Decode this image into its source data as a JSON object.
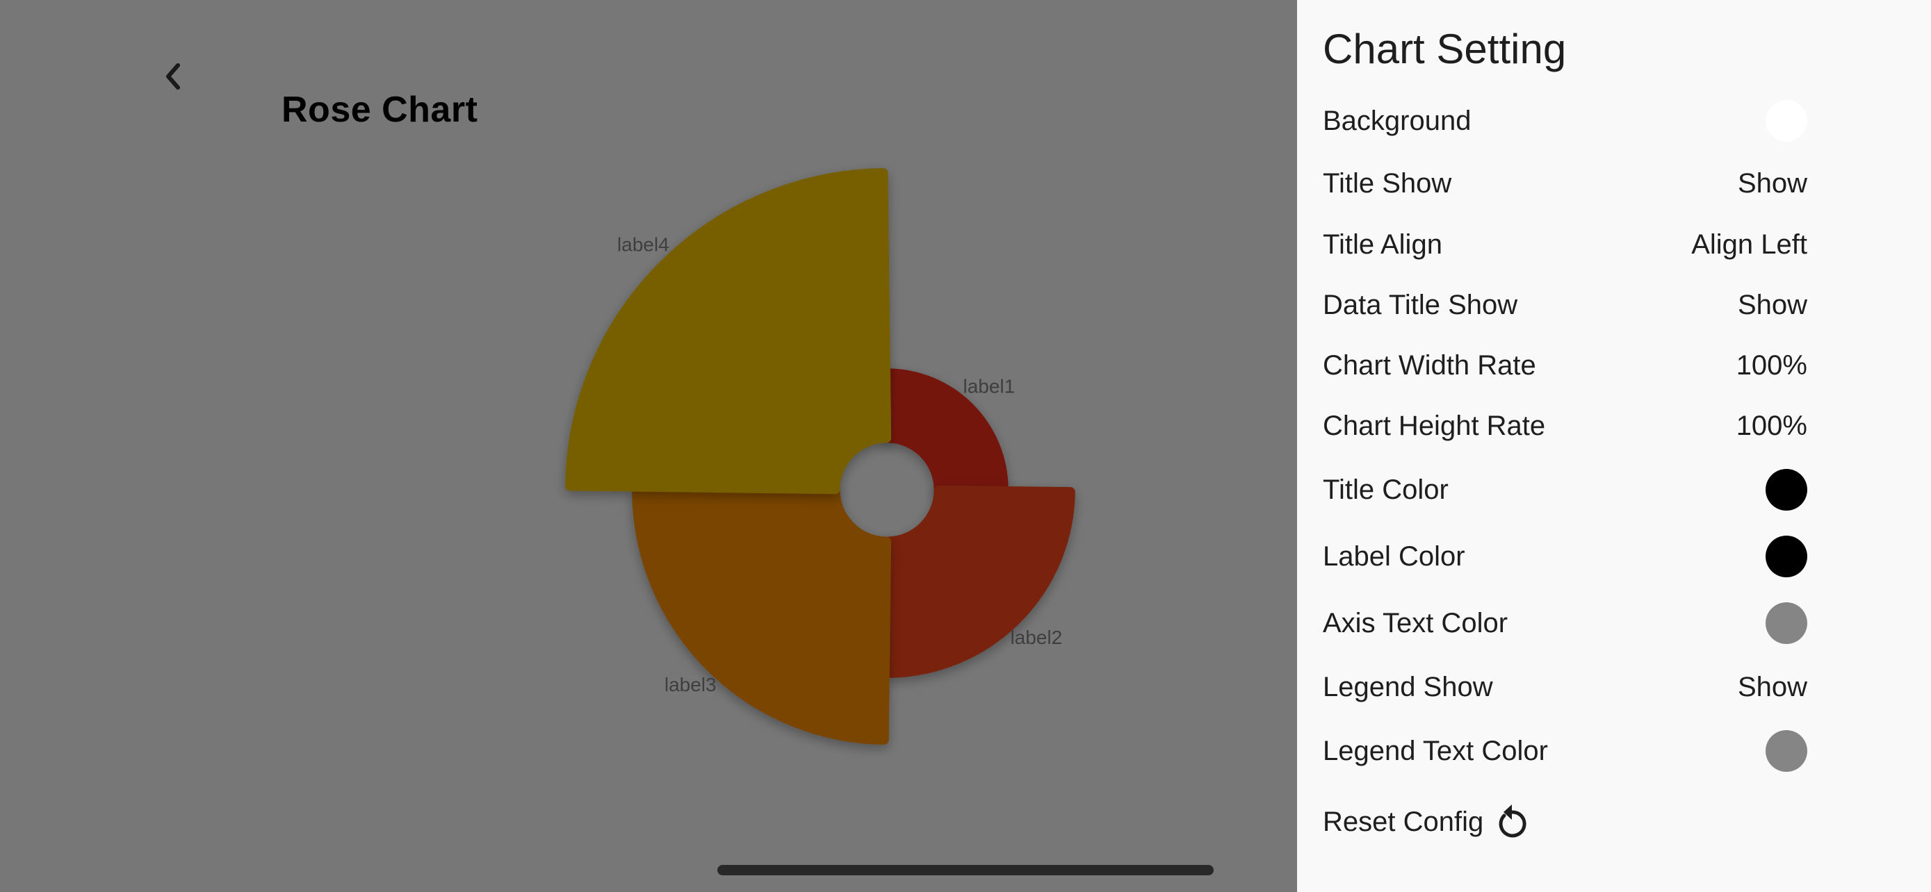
{
  "header": {
    "back_icon": "chevron-left-icon",
    "title": "Rose Chart"
  },
  "chart_data": {
    "type": "rose",
    "title": "Rose Chart",
    "categories": [
      "label1",
      "label2",
      "label3",
      "label4"
    ],
    "values": [
      1,
      2,
      3,
      4
    ],
    "colors": [
      "#e8291f",
      "#f2481a",
      "#f28a00",
      "#edbd00"
    ],
    "overlay_dimmed": true,
    "inner_radius_ratio": 0.157,
    "legend": "none"
  },
  "panel": {
    "title": "Chart Setting",
    "rows": [
      {
        "label": "Background",
        "type": "color",
        "value": "#ffffff"
      },
      {
        "label": "Title Show",
        "type": "text",
        "value": "Show"
      },
      {
        "label": "Title Align",
        "type": "text",
        "value": "Align Left"
      },
      {
        "label": "Data Title Show",
        "type": "text",
        "value": "Show"
      },
      {
        "label": "Chart Width Rate",
        "type": "text",
        "value": "100%"
      },
      {
        "label": "Chart Height Rate",
        "type": "text",
        "value": "100%"
      },
      {
        "label": "Title Color",
        "type": "color",
        "value": "#000000"
      },
      {
        "label": "Label Color",
        "type": "color",
        "value": "#000000"
      },
      {
        "label": "Axis Text Color",
        "type": "color",
        "value": "#858585"
      },
      {
        "label": "Legend Show",
        "type": "text",
        "value": "Show"
      },
      {
        "label": "Legend Text Color",
        "type": "color",
        "value": "#858585"
      }
    ],
    "reset_label": "Reset Config",
    "reset_icon": "reset-icon"
  }
}
